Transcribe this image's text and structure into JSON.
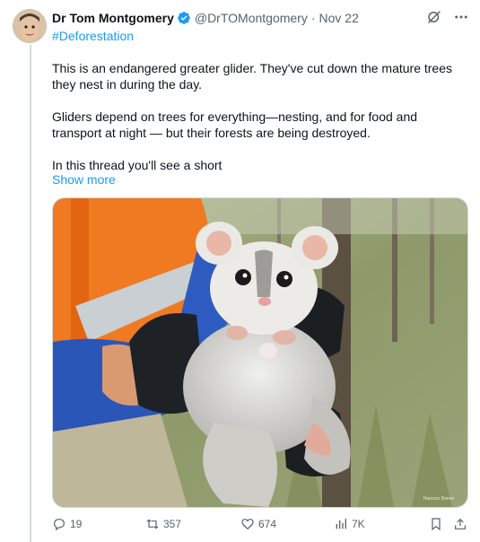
{
  "tweet": {
    "author_name": "Dr Tom Montgomery",
    "handle": "@DrTOMontgomery",
    "separator": "·",
    "date": "Nov 22",
    "hashtag": "#Deforestation",
    "paragraphs": [
      "This is an endangered greater glider. They've cut down the mature trees they nest in during the day.",
      "Gliders depend on trees for everything—nesting, and for food and transport at night — but their forests are being destroyed.",
      "In this thread you'll see a short"
    ],
    "show_more": "Show more",
    "media_watermark": "Hancom Bonne"
  },
  "actions": {
    "replies": "19",
    "reposts": "357",
    "likes": "674",
    "views": "7K"
  },
  "colors": {
    "accent": "#1d9bf0",
    "muted": "#536471",
    "text": "#0f1419",
    "border": "#cfd9de"
  },
  "icons": [
    "verified-badge-icon",
    "grok-icon",
    "more-icon",
    "reply-icon",
    "repost-icon",
    "like-icon",
    "views-icon",
    "bookmark-icon",
    "share-icon"
  ]
}
